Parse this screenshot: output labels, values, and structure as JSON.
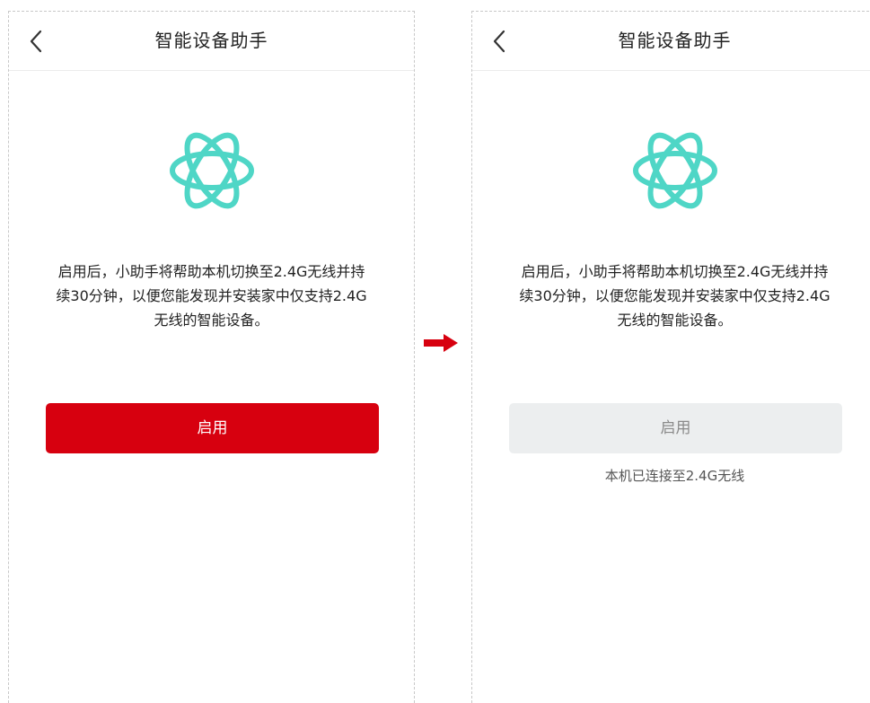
{
  "colors": {
    "accent_red": "#d7000f",
    "logo_teal": "#4fd6c6",
    "disabled_button_bg": "#eceeef"
  },
  "icons": {
    "back": "chevron-left-icon",
    "logo": "atom-orbit-icon",
    "transition": "arrow-right-icon"
  },
  "before": {
    "header": {
      "title": "智能设备助手"
    },
    "description_lines": [
      "启用后，小助手将帮助本机切换至2.4G无线并持",
      "续30分钟，以便您能发现并安装家中仅支持2.4G",
      "无线的智能设备。"
    ],
    "button": {
      "label": "启用",
      "state": "enabled"
    }
  },
  "after": {
    "header": {
      "title": "智能设备助手"
    },
    "description_lines": [
      "启用后，小助手将帮助本机切换至2.4G无线并持",
      "续30分钟，以便您能发现并安装家中仅支持2.4G",
      "无线的智能设备。"
    ],
    "button": {
      "label": "启用",
      "state": "disabled"
    },
    "status_text": "本机已连接至2.4G无线"
  }
}
